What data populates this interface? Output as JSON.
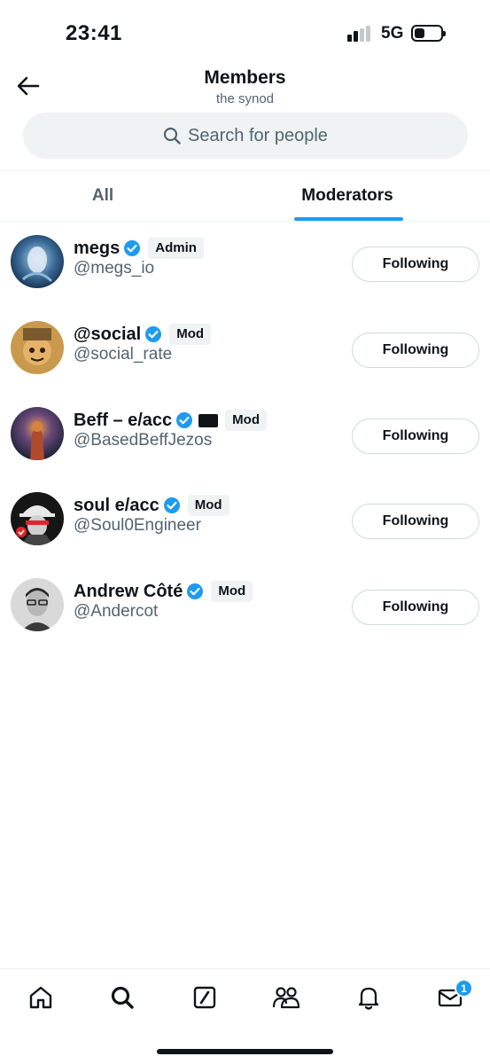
{
  "status_bar": {
    "time": "23:41",
    "network": "5G"
  },
  "header": {
    "title": "Members",
    "subtitle": "the synod"
  },
  "search": {
    "placeholder": "Search for people"
  },
  "tabs": [
    {
      "label": "All",
      "selected": false
    },
    {
      "label": "Moderators",
      "selected": true
    }
  ],
  "members": [
    {
      "name": "megs",
      "handle": "@megs_io",
      "role": "Admin",
      "verified": true,
      "button": "Following"
    },
    {
      "name": "@social",
      "handle": "@social_rate",
      "role": "Mod",
      "verified": true,
      "button": "Following"
    },
    {
      "name": "Beff – e/acc",
      "handle": "@BasedBeffJezos",
      "role": "Mod",
      "verified": true,
      "button": "Following"
    },
    {
      "name": "soul e/acc",
      "handle": "@Soul0Engineer",
      "role": "Mod",
      "verified": true,
      "button": "Following"
    },
    {
      "name": "Andrew Côté",
      "handle": "@Andercot",
      "role": "Mod",
      "verified": true,
      "button": "Following"
    }
  ],
  "bottom_nav": {
    "items": [
      "home-icon",
      "search-icon",
      "grok-icon",
      "communities-icon",
      "notifications-icon",
      "messages-icon"
    ],
    "messages_badge": "1"
  },
  "colors": {
    "accent": "#1d9bf0",
    "text": "#0f1419",
    "secondary": "#536471",
    "badge_bg": "#eff3f4"
  }
}
